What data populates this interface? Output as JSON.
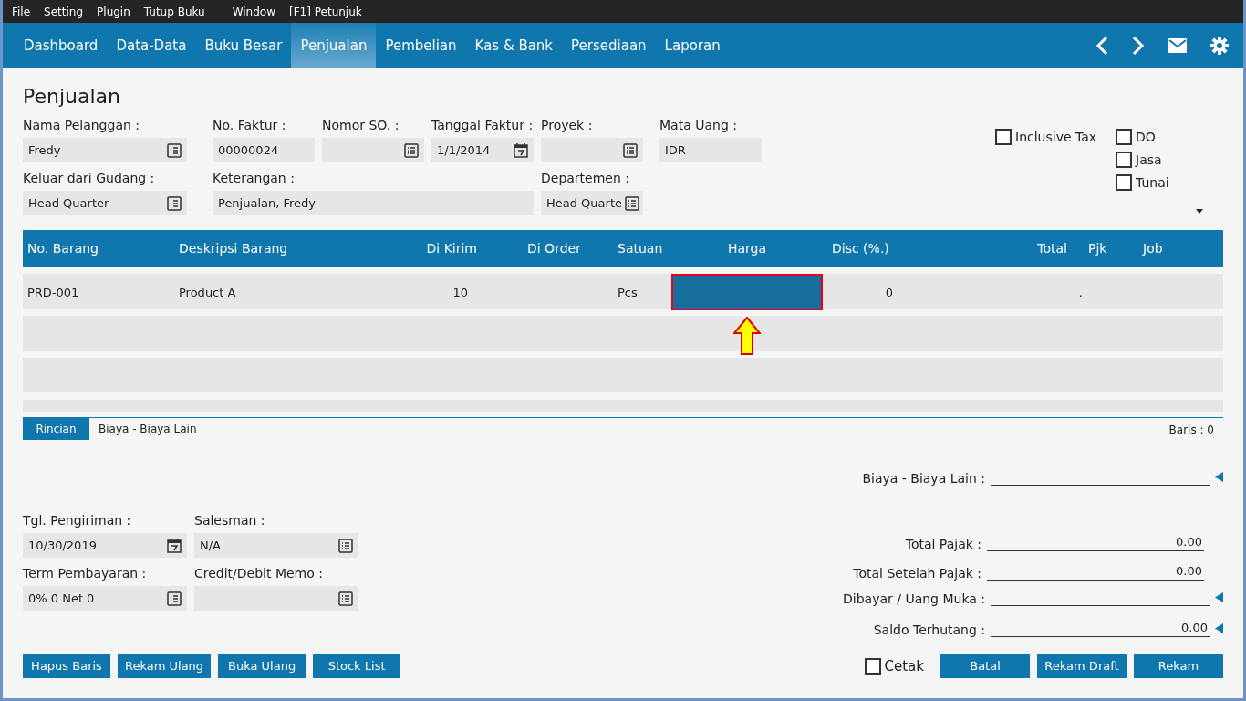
{
  "menu": [
    "File",
    "Setting",
    "Plugin",
    "Tutup Buku",
    "Window",
    "[F1] Petunjuk"
  ],
  "nav": {
    "tabs": [
      {
        "label": "Dashboard",
        "selected": false
      },
      {
        "label": "Data-Data",
        "selected": false
      },
      {
        "label": "Buku Besar",
        "selected": false
      },
      {
        "label": "Penjualan",
        "selected": true
      },
      {
        "label": "Pembelian",
        "selected": false
      },
      {
        "label": "Kas & Bank",
        "selected": false
      },
      {
        "label": "Persediaan",
        "selected": false
      },
      {
        "label": "Laporan",
        "selected": false
      }
    ]
  },
  "page_title": "Penjualan",
  "header_fields_1": [
    {
      "label": "Nama Pelanggan :",
      "value": "Fredy",
      "kind": "lookup"
    },
    {
      "label": "No. Faktur :",
      "value": "00000024",
      "kind": "text"
    },
    {
      "label": "Nomor SO. :",
      "kind": "lookup"
    },
    {
      "label": "Tanggal Faktur :",
      "value": "1/1/2014",
      "kind": "date"
    },
    {
      "label": "Proyek :",
      "kind": "lookup"
    },
    {
      "label": "Mata Uang :",
      "value": "IDR",
      "kind": "text"
    }
  ],
  "header_fields_2": [
    {
      "label": "Keluar dari Gudang :",
      "value": "Head Quarter",
      "kind": "lookup"
    },
    {
      "label": "Keterangan :",
      "value": "Penjualan, Fredy",
      "kind": "text"
    },
    {
      "label": "Departemen :",
      "value": "Head Quarte",
      "kind": "lookup"
    }
  ],
  "options": [
    {
      "label": "Inclusive Tax",
      "checked": false
    },
    {
      "label": "DO",
      "checked": false
    },
    {
      "label": "Jasa",
      "checked": false
    },
    {
      "label": "Tunai",
      "checked": false
    }
  ],
  "table": {
    "columns": [
      "No. Barang",
      "Deskripsi Barang",
      "Di Kirim",
      "Di Order",
      "Satuan",
      "Harga",
      "Disc (%.)",
      "Total",
      "Pjk",
      "Job"
    ],
    "rows": [
      {
        "no_barang": "PRD-001",
        "deskripsi": "Product A",
        "di_kirim": "10",
        "satuan": "Pcs",
        "harga_selected": true,
        "disc": "0",
        "total": "."
      }
    ]
  },
  "bottom_tabs": [
    {
      "label": "Rincian",
      "selected": true
    },
    {
      "label": "Biaya - Biaya Lain",
      "selected": false
    }
  ],
  "row_count": "Baris : 0",
  "lower_fields": [
    {
      "label": "Tgl. Pengiriman :",
      "value": "10/30/2019",
      "kind": "date"
    },
    {
      "label": "Salesman :",
      "value": "N/A",
      "kind": "lookup"
    },
    {
      "label": "Term Pembayaran :",
      "value": "0% 0 Net 0",
      "kind": "lookup"
    },
    {
      "label": "Credit/Debit Memo :",
      "kind": "lookup"
    }
  ],
  "summary": [
    {
      "label": "Biaya - Biaya Lain :",
      "expandable": true
    },
    {
      "label": "Total Pajak :",
      "value": "0.00",
      "expandable": false
    },
    {
      "label": "Total Setelah Pajak :",
      "value": "0.00",
      "expandable": false
    },
    {
      "label": "Dibayar / Uang Muka :",
      "expandable": true
    },
    {
      "label": "Saldo Terhutang :",
      "value": "0.00",
      "expandable": true
    }
  ],
  "left_buttons": [
    "Hapus Baris",
    "Rekam Ulang",
    "Buka Ulang",
    "Stock List"
  ],
  "print_option": {
    "label": "Cetak",
    "checked": false
  },
  "right_buttons": [
    "Batal",
    "Rekam Draft",
    "Rekam"
  ]
}
